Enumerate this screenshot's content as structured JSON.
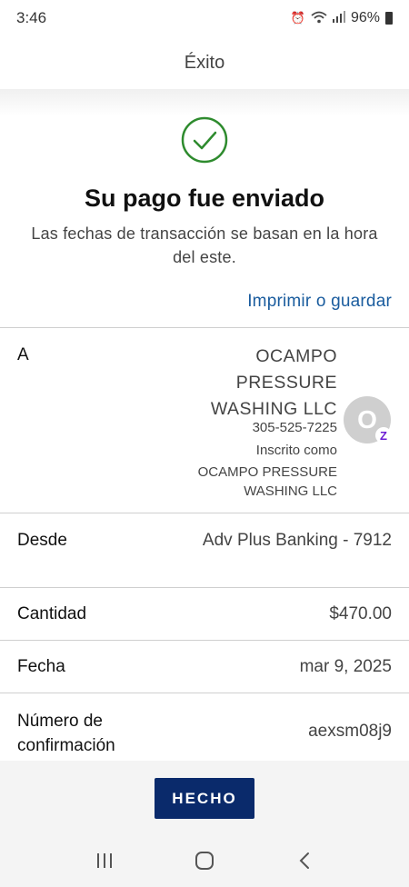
{
  "status_bar": {
    "time": "3:46",
    "battery": "96%",
    "icons": [
      "alarm-icon",
      "wifi-icon",
      "signal-icon",
      "battery-icon"
    ]
  },
  "header": {
    "title": "Éxito"
  },
  "success": {
    "icon": "check-circle-icon",
    "title": "Su pago fue enviado",
    "subtitle": "Las fechas de transacción se basan en la hora del este."
  },
  "print_link": "Imprimir o guardar",
  "details": {
    "to": {
      "label": "A",
      "name": "OCAMPO PRESSURE WASHING LLC",
      "phone": "305-525-7225",
      "enrolled_label": "Inscrito como",
      "enrolled_name": "OCAMPO PRESSURE WASHING LLC",
      "avatar_initial": "O",
      "badge": "Z"
    },
    "from": {
      "label": "Desde",
      "value": "Adv Plus Banking - 7912"
    },
    "amount": {
      "label": "Cantidad",
      "value": "$470.00"
    },
    "date": {
      "label": "Fecha",
      "value": "mar 9, 2025"
    },
    "confirmation": {
      "label": "Número de confirmación",
      "value": "aexsm08j9"
    }
  },
  "done_button": "HECHO",
  "nav": {
    "icons": [
      "recent-apps-icon",
      "home-icon",
      "back-icon"
    ]
  },
  "colors": {
    "accent": "#1a5c9e",
    "button": "#0a2a6b",
    "success": "#2e8b2e"
  }
}
